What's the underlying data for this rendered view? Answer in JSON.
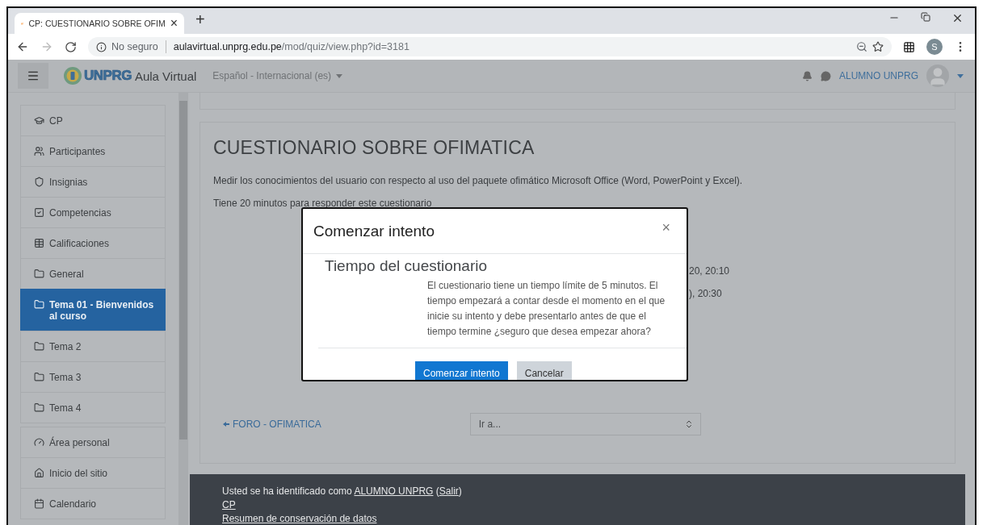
{
  "browser": {
    "tab": {
      "title": "CP: CUESTIONARIO SOBRE OFIM",
      "close": "×",
      "selected": true
    },
    "new_tab": "+",
    "back": {
      "disabled": false
    },
    "forward": {
      "disabled": true
    },
    "security": "No seguro",
    "url_host": "aulavirtual.unprg.edu.pe",
    "url_path": "/mod/quiz/view.php?id=3181",
    "profile_initial": "S"
  },
  "navbar": {
    "logo": "UNPRG",
    "site_name": "Aula Virtual",
    "language": "Español - Internacional (es)",
    "user_name": "ALUMNO UNPRG"
  },
  "sidebar": {
    "groups": [
      {
        "items": [
          {
            "label": "CP",
            "selected": false
          },
          {
            "label": "Participantes",
            "selected": false
          },
          {
            "label": "Insignias",
            "selected": false
          },
          {
            "label": "Competencias",
            "selected": false
          },
          {
            "label": "Calificaciones",
            "selected": false
          },
          {
            "label": "General",
            "selected": false
          },
          {
            "label": "Tema 01 - Bienvenidos al curso",
            "selected": true
          },
          {
            "label": "Tema 2",
            "selected": false
          },
          {
            "label": "Tema 3",
            "selected": false
          },
          {
            "label": "Tema 4",
            "selected": false
          }
        ]
      },
      {
        "items": [
          {
            "label": "Área personal",
            "selected": false
          },
          {
            "label": "Inicio del sitio",
            "selected": false
          },
          {
            "label": "Calendario",
            "selected": false
          }
        ]
      }
    ]
  },
  "quiz": {
    "title": "CUESTIONARIO SOBRE OFIMATICA",
    "description": "Medir los conocimientos del usuario con respecto al uso del paquete ofimático Microsoft Office (Word, PowerPoint y Excel).",
    "time_note": "Tiene 20 minutos para responder este cuestionario",
    "dates_partial": [
      "20, 20:10",
      "), 20:30"
    ],
    "prev_link": "FORO - OFIMATICA",
    "jump_select": {
      "value": "Ir a..."
    }
  },
  "footer": {
    "login": [
      {
        "kind": "text",
        "text": "Usted se ha identificado como "
      },
      {
        "kind": "link",
        "text": "ALUMNO UNPRG"
      },
      {
        "kind": "text",
        "text": " ("
      },
      {
        "kind": "link",
        "text": "Salir"
      },
      {
        "kind": "text",
        "text": ")"
      }
    ],
    "course_link": "CP",
    "data_link": "Resumen de conservación de datos"
  },
  "modal": {
    "title": "Comenzar intento",
    "close": "×",
    "section_title": "Tiempo del cuestionario",
    "message": "El cuestionario tiene un tiempo límite de 5 minutos. El tiempo empezará a contar desde el momento en el que inicie su intento y debe presentarlo antes de que el tiempo termine ¿seguro que desea empezar ahora?",
    "buttons": [
      {
        "label": "Comenzar intento",
        "kind": "primary"
      },
      {
        "label": "Cancelar",
        "kind": "secondary"
      }
    ]
  }
}
